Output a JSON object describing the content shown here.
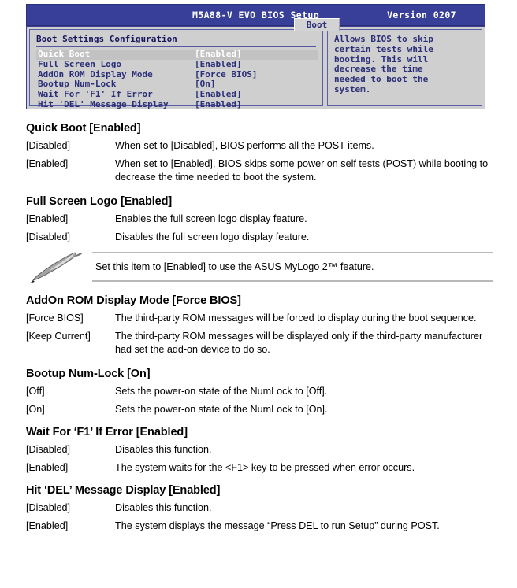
{
  "bios": {
    "title": "M5A88-V EVO BIOS Setup",
    "version": "Version 0207",
    "active_tab": "Boot",
    "section_title": "Boot Settings Configuration",
    "rows": [
      {
        "label": "Quick Boot",
        "value": "[Enabled]",
        "selected": true
      },
      {
        "label": "Full Screen Logo",
        "value": "[Enabled]",
        "selected": false
      },
      {
        "label": "AddOn ROM Display Mode",
        "value": "[Force BIOS]",
        "selected": false
      },
      {
        "label": "Bootup Num-Lock",
        "value": "[On]",
        "selected": false
      },
      {
        "label": "Wait For 'F1' If Error",
        "value": "[Enabled]",
        "selected": false
      },
      {
        "label": "Hit 'DEL' Message Display",
        "value": "[Enabled]",
        "selected": false
      }
    ],
    "help_text": "Allows BIOS to skip\ncertain tests while\nbooting. This will\ndecrease the time\nneeded to boot the\nsystem.",
    "colors": {
      "titlebar_blue": "#383f98",
      "panel_gray": "#cfcfcf",
      "text_blue": "#2b2f78",
      "tab_gray": "#d3d3d3",
      "selected_bg": "#c2c2c2",
      "selected_text": "#ffffff"
    }
  },
  "sections": [
    {
      "heading": "Quick Boot [Enabled]",
      "options": [
        {
          "key": "[Disabled]",
          "desc": "When set to [Disabled], BIOS performs all the POST items."
        },
        {
          "key": "[Enabled]",
          "desc": "When set to [Enabled], BIOS skips some power on self tests (POST) while booting to decrease the time needed to boot the system."
        }
      ]
    },
    {
      "heading": "Full Screen Logo [Enabled]",
      "options": [
        {
          "key": "[Enabled]",
          "desc": "Enables the full screen logo display feature."
        },
        {
          "key": "[Disabled]",
          "desc": "Disables the full screen logo display feature."
        }
      ]
    },
    {
      "heading": "AddOn ROM Display Mode [Force BIOS]",
      "options": [
        {
          "key": "[Force BIOS]",
          "desc": "The third-party ROM messages will be forced to display during the boot sequence."
        },
        {
          "key": "[Keep Current]",
          "desc": "The third-party ROM messages will be displayed only if the third-party manufacturer had set the add-on device to do so."
        }
      ]
    },
    {
      "heading": "Bootup Num-Lock [On]",
      "options": [
        {
          "key": "[Off]",
          "desc": "Sets the power-on state of the NumLock to [Off]."
        },
        {
          "key": "[On]",
          "desc": "Sets the power-on state of the NumLock to [On]."
        }
      ]
    },
    {
      "heading": "Wait For ‘F1’ If Error [Enabled]",
      "options": [
        {
          "key": "[Disabled]",
          "desc": "Disables this function."
        },
        {
          "key": "[Enabled]",
          "desc": "The system waits for the <F1> key to be pressed when error occurs."
        }
      ]
    },
    {
      "heading": "Hit ‘DEL’ Message Display [Enabled]",
      "options": [
        {
          "key": "[Disabled]",
          "desc": "Disables this function."
        },
        {
          "key": "[Enabled]",
          "desc": "The system displays the message “Press DEL to run Setup” during POST."
        }
      ]
    }
  ],
  "note": {
    "icon": "pencil-icon",
    "text": "Set this item to [Enabled] to use the ASUS MyLogo 2™ feature."
  }
}
